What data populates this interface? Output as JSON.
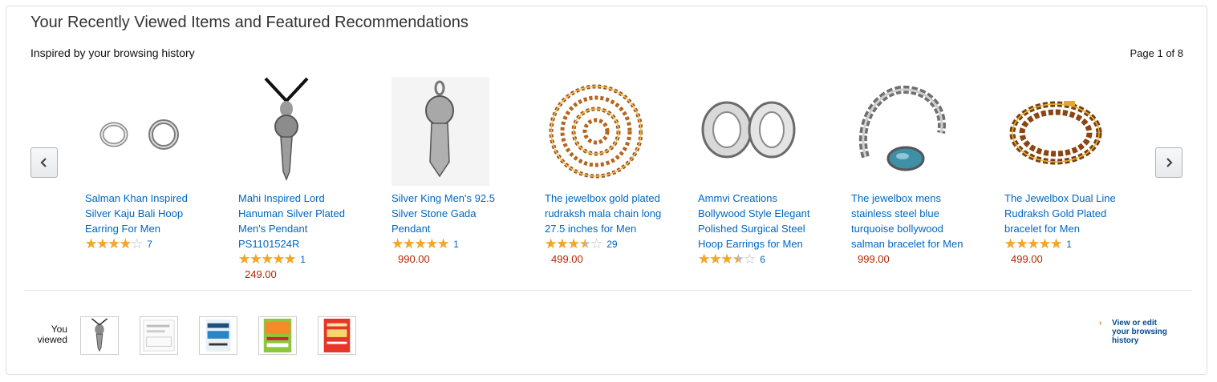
{
  "header": {
    "title": "Your Recently Viewed Items and Featured Recommendations",
    "subtitle": "Inspired by your browsing history",
    "page_indicator": "Page 1 of 8"
  },
  "carousel": {
    "items": [
      {
        "title": "Salman Khan Inspired Silver Kaju Bali Hoop Earring For Men",
        "rating": 4,
        "reviews": "7",
        "price": "",
        "image": "hoop-earrings-image"
      },
      {
        "title": "Mahi Inspired Lord Hanuman Silver Plated Men's Pendant PS1101524R",
        "rating": 5,
        "reviews": "1",
        "price": "249.00",
        "image": "gada-pendant-cord-image"
      },
      {
        "title": "Silver King Men's 92.5 Silver Stone Gada Pendant",
        "rating": 5,
        "reviews": "1",
        "price": "990.00",
        "image": "gada-pendant-image"
      },
      {
        "title": "The jewelbox gold plated rudraksh mala chain long 27.5 inches for Men",
        "rating": 3.5,
        "reviews": "29",
        "price": "499.00",
        "image": "rudraksh-mala-image"
      },
      {
        "title": "Ammvi Creations Bollywood Style Elegant Polished Surgical Steel Hoop Earrings for Men",
        "rating": 3.5,
        "reviews": "6",
        "price": "",
        "image": "steel-hoop-earrings-image"
      },
      {
        "title": "The jewelbox mens stainless steel blue turquoise bollywood salman bracelet for Men",
        "rating": 0,
        "reviews": "",
        "price": "999.00",
        "image": "turquoise-bracelet-image"
      },
      {
        "title": "The Jewelbox Dual Line Rudraksh Gold Plated bracelet for Men",
        "rating": 5,
        "reviews": "1",
        "price": "499.00",
        "image": "rudraksh-bracelet-image"
      }
    ]
  },
  "history": {
    "label": "You viewed",
    "thumbnails": [
      "pendant-thumb",
      "business-model-generation-book-thumb",
      "startup-owners-manual-book-thumb",
      "how-to-win-friends-book-thumb",
      "influence-book-thumb"
    ],
    "edit_link": "View or edit your browsing history"
  },
  "colors": {
    "link": "#0066c0",
    "price": "#b12704",
    "star": "#f5a623",
    "title": "#333333"
  }
}
